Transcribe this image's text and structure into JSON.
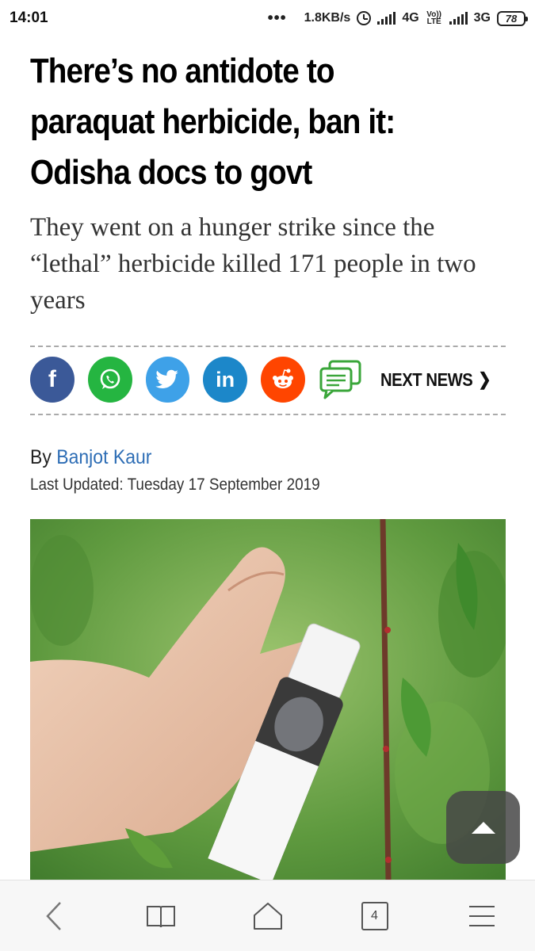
{
  "status_bar": {
    "time": "14:01",
    "dots": "•••",
    "speed": "1.8KB/s",
    "network_1": "4G",
    "volte": "Vo)) LTE",
    "network_2": "3G",
    "battery": "78"
  },
  "article": {
    "headline_lines": [
      "There’s no antidote to",
      "paraquat herbicide, ban it:",
      "Odisha docs to govt"
    ],
    "subhead": "They went on a hunger strike since the “lethal” herbicide killed 171 people in two years",
    "by_prefix": "By",
    "author": "Banjot Kaur",
    "last_updated": "Last Updated: Tuesday 17 September 2019"
  },
  "share": {
    "facebook_icon": "facebook-icon",
    "whatsapp_icon": "whatsapp-icon",
    "twitter_icon": "twitter-icon",
    "linkedin_label": "in",
    "facebook_label": "f",
    "reddit_icon": "reddit-icon",
    "comment_icon": "comment-icon",
    "next_news": "NEXT NEWS",
    "next_chevron": "❯"
  },
  "browser_bar": {
    "back_icon": "back-icon",
    "bookmarks_icon": "book-icon",
    "home_icon": "home-icon",
    "tab_count": "4",
    "menu_icon": "menu-icon"
  },
  "colors": {
    "facebook": "#3b5998",
    "whatsapp": "#25b541",
    "twitter": "#3ea1e8",
    "linkedin": "#1c87c9",
    "reddit": "#ff4500",
    "comment": "#3aa63a",
    "author_link": "#2d6db5"
  }
}
